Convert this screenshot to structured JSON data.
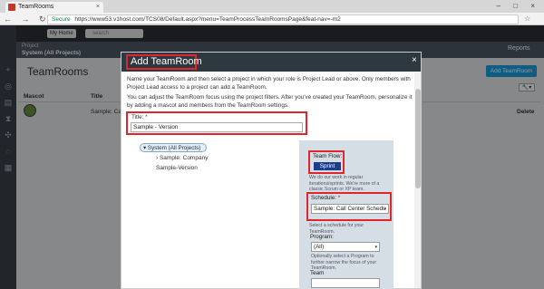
{
  "browser": {
    "tab_title": "TeamRooms",
    "tab_close": "×",
    "window_controls": "– □ ×",
    "nav_buttons": "← → ↻",
    "secure_label": "Secure",
    "url": "https://www53.v1host.com/TCS08/Default.aspx?menu=TeamProcessTeamRoomsPage&feat-nav=-m2",
    "star": "☆"
  },
  "app": {
    "my_home": "My Home ▾",
    "search_placeholder": "search",
    "project_label": "Project",
    "project_name": "System (All Projects)",
    "reports": "Reports",
    "page_title": "TeamRooms",
    "add_button": "Add TeamRoom",
    "tool_button": "🔧▾",
    "columns": [
      "Mascot",
      "Title"
    ],
    "row": {
      "title": "Sample: Call",
      "delete": "Delete"
    }
  },
  "modal": {
    "title": "Add TeamRoom",
    "close": "×",
    "para1": "Name your TeamRoom and then select a project in which your role is Project Lead or above. Only members with Project Lead access to a project can add a TeamRoom.",
    "para2": "You can adjust the TeamRoom focus using the project filters. After you've created your TeamRoom, personalize it by adding a mascot and members from the TeamRoom settings.",
    "title_label": "Title:",
    "required_star": "*",
    "title_value": "Sample - Version",
    "tree": {
      "root": "▾ System (All Projects)",
      "children": [
        "› Sample: Company",
        "Sample-Version"
      ]
    },
    "team_flow_label": "Team Flow:",
    "sprint_label": "Sprint",
    "flow_help": "We do our work in regular iterations/sprints. We're more of a classic Scrum or XP team.",
    "schedule_label": "Schedule:",
    "schedule_value": "Sample: Call Center Schedu",
    "schedule_help": "Select a schedule for your TeamRoom.",
    "program_label": "Program:",
    "program_value": "(All)",
    "program_help": "Optionally select a Program to further narrow the focus of your TeamRoom.",
    "team_label": "Team",
    "dropdown_arrow": "▾"
  },
  "colors": {
    "highlight": "#e0252c",
    "accent": "#1ba1e2",
    "sprint": "#1c3c8c",
    "modal_header": "#2e3840"
  }
}
